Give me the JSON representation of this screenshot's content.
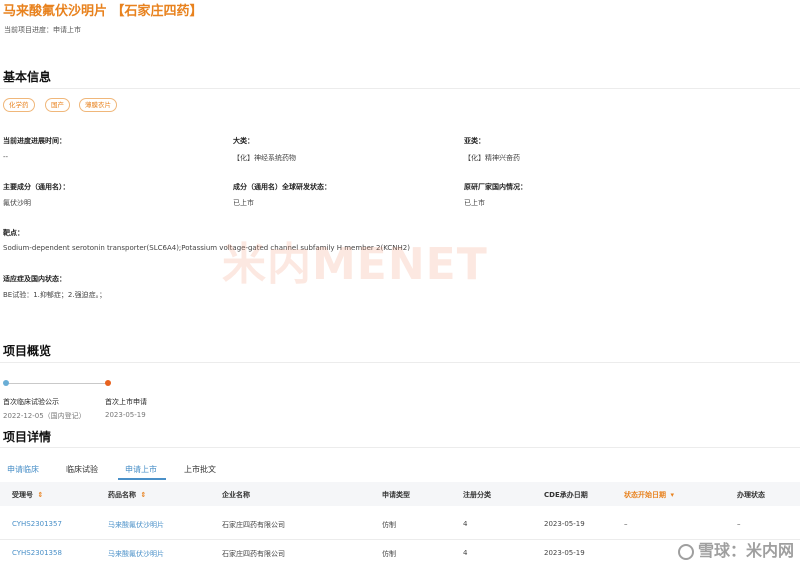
{
  "header": {
    "title": "马来酸氟伏沙明片 【石家庄四药】",
    "progress": "当前项目进度：申请上市"
  },
  "basic_info": {
    "heading": "基本信息",
    "tags": [
      "化学药",
      "国产",
      "薄膜衣片"
    ],
    "fields": {
      "progress_time": {
        "label": "当前进度进展时间：",
        "value": "--"
      },
      "major_class": {
        "label": "大类：",
        "value": "【化】神经系统药物"
      },
      "sub_class": {
        "label": "亚类：",
        "value": "【化】精神兴奋药"
      },
      "main_ingredient": {
        "label": "主要成分（通用名）：",
        "value": "氟伏沙明"
      },
      "global_status": {
        "label": "成分（通用名）全球研发状态：",
        "value": "已上市"
      },
      "origin_status": {
        "label": "原研厂家国内情况：",
        "value": "已上市"
      },
      "target": {
        "label": "靶点：",
        "value": "Sodium-dependent serotonin transporter(SLC6A4);Potassium voltage-gated channel subfamily H member 2(KCNH2)"
      },
      "indication": {
        "label": "适应症及国内状态：",
        "value": "BE试验：1.抑郁症；2.强迫症。；"
      }
    }
  },
  "watermark": "米内MENET",
  "overview": {
    "heading": "项目概览",
    "timeline": [
      {
        "name": "首次临床试验公示",
        "date": "2022-12-05（国内登记）",
        "color": "#6aaed6"
      },
      {
        "name": "首次上市申请",
        "date": "2023-05-19",
        "color": "#e8621e"
      }
    ]
  },
  "details": {
    "heading": "项目详情",
    "tabs": [
      "申请临床",
      "临床试验",
      "申请上市",
      "上市批文"
    ],
    "active_tab": "申请上市",
    "columns": [
      "受理号",
      "药品名称",
      "企业名称",
      "申请类型",
      "注册分类",
      "CDE承办日期",
      "状态开始日期",
      "办理状态"
    ],
    "sort_icon": "⇕",
    "sort_active_icon": "▾",
    "rows": [
      [
        "CYHS2301357",
        "马来酸氟伏沙明片",
        "石家庄四药有限公司",
        "仿制",
        "4",
        "2023-05-19",
        "–",
        "–"
      ],
      [
        "CYHS2301358",
        "马来酸氟伏沙明片",
        "石家庄四药有限公司",
        "仿制",
        "4",
        "2023-05-19",
        "",
        ""
      ]
    ]
  },
  "footer_watermark": "雪球：米内网",
  "colors": {
    "accent": "#e8821e",
    "link": "#4a90c8"
  }
}
